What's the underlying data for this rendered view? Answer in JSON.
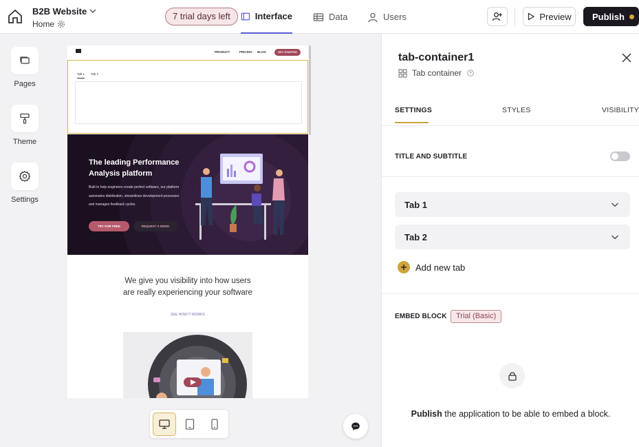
{
  "header": {
    "site_name": "B2B Website",
    "page_name": "Home",
    "trial_label": "7 trial days left",
    "tabs": [
      {
        "label": "Interface",
        "icon": "interface-icon",
        "active": true
      },
      {
        "label": "Data",
        "icon": "table-icon",
        "active": false
      },
      {
        "label": "Users",
        "icon": "user-icon",
        "active": false
      }
    ],
    "preview_label": "Preview",
    "publish_label": "Publish",
    "accent_color": "#5b5bd6",
    "publish_dot_color": "#d9a53a"
  },
  "rail": {
    "items": [
      {
        "label": "Pages",
        "icon": "pages-icon"
      },
      {
        "label": "Theme",
        "icon": "paint-roller-icon"
      },
      {
        "label": "Settings",
        "icon": "gear-icon"
      }
    ]
  },
  "canvas": {
    "nav_links": [
      "PRODUCT",
      "PRICING",
      "BLOG"
    ],
    "cta": "GET STARTED",
    "tabs": [
      "Tab 1",
      "Tab 2"
    ],
    "hero_title": "The leading Performance Analysis platform",
    "hero_body": "Built to help engineers create perfect software, our platform automates distribution, streamlines development processes and manages feedback cycles.",
    "try_label": "TRY FOR FREE",
    "demo_label": "REQUEST A DEMO",
    "subheading": "We give you visibility into how users are really experiencing your software",
    "see_link": "SEE HOW IT WORKS"
  },
  "panel": {
    "title": "tab-container1",
    "type_label": "Tab container",
    "tabs": [
      "SETTINGS",
      "STYLES",
      "VISIBILITY"
    ],
    "title_subtitle_label": "TITLE AND SUBTITLE",
    "title_subtitle_enabled": false,
    "accordion": [
      "Tab 1",
      "Tab 2"
    ],
    "add_tab_label": "Add new tab",
    "embed_label": "EMBED BLOCK",
    "embed_badge": "Trial (Basic)",
    "embed_msg_bold": "Publish",
    "embed_msg_rest": " the application to be able to embed a block."
  }
}
